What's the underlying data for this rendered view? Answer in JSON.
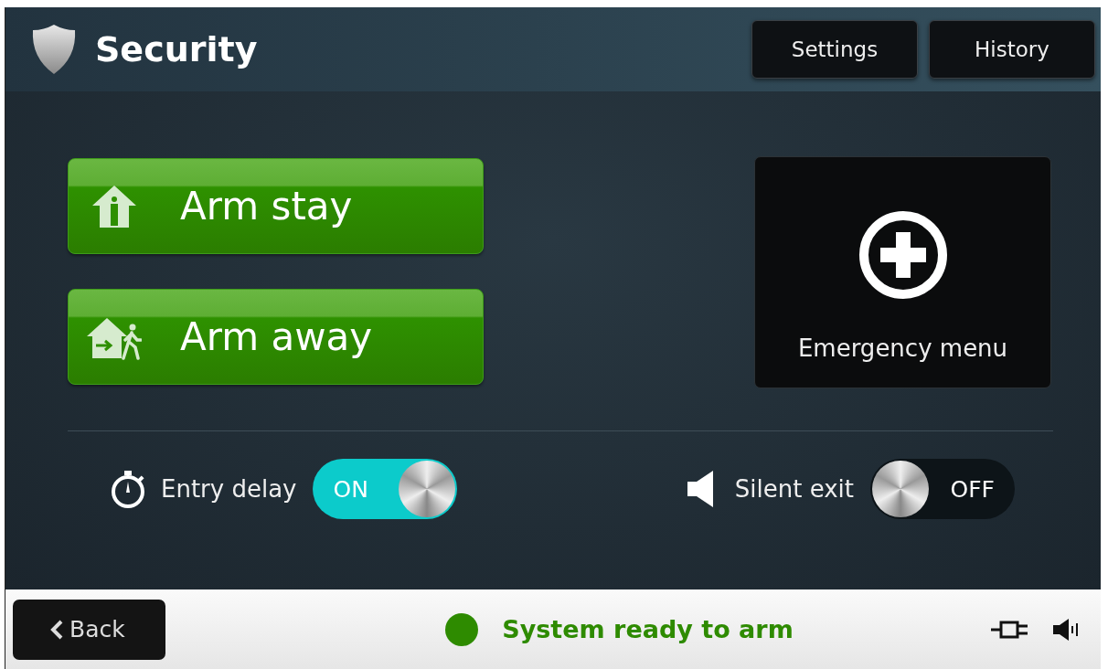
{
  "header": {
    "title": "Security",
    "buttons": [
      "Settings",
      "History"
    ]
  },
  "arm_buttons": [
    {
      "kind": "stay",
      "label": "Arm stay"
    },
    {
      "kind": "away",
      "label": "Arm away"
    }
  ],
  "emergency": {
    "label": "Emergency menu"
  },
  "toggles": [
    {
      "kind": "timer",
      "label": "Entry delay",
      "on": true,
      "state_text": "ON"
    },
    {
      "kind": "speaker",
      "label": "Silent exit",
      "on": false,
      "state_text": "OFF"
    }
  ],
  "footer": {
    "back": "Back",
    "status": {
      "text": "System ready to arm",
      "color": "#2e8b00"
    }
  }
}
